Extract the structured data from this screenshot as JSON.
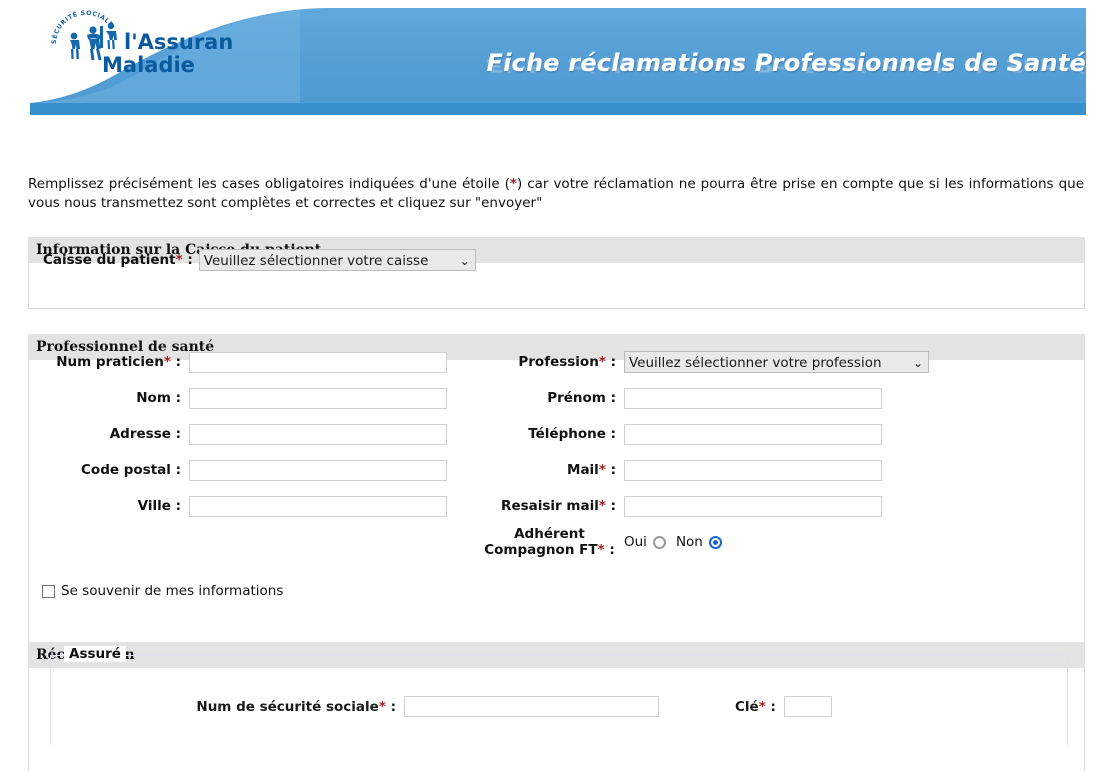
{
  "header": {
    "logo_top_text": "SÉCURITÉ SOCIALE",
    "logo_line1": "l'Assurance",
    "logo_line2": "Maladie",
    "title": "Fiche réclamations Professionnels de Santé",
    "brand_blue": "#5ba4da",
    "brand_blue_dark": "#2e86c8",
    "logo_blue": "#0a5aa0"
  },
  "intro": {
    "part1": "Remplissez précisément les cases obligatoires indiquées d'une étoile (",
    "asterisk": "*",
    "part2": ") car votre réclamation ne pourra être prise en compte que si les informations que vous nous transmettez sont complètes et correctes et cliquez sur \"envoyer\""
  },
  "sections": {
    "caisse": {
      "title": "Information sur la Caisse du patient",
      "label": "Caisse du patient",
      "required_mark": "*",
      "colon": " :",
      "select_value": "Veuillez sélectionner votre caisse",
      "chevron": "⌄"
    },
    "professionnel": {
      "title": "Professionnel de santé",
      "left_fields": [
        {
          "label": "Num praticien",
          "required": "*",
          "colon": " :",
          "value": ""
        },
        {
          "label": "Nom",
          "required": "",
          "colon": " :",
          "value": ""
        },
        {
          "label": "Adresse",
          "required": "",
          "colon": " :",
          "value": ""
        },
        {
          "label": "Code postal",
          "required": "",
          "colon": " :",
          "value": ""
        },
        {
          "label": "Ville",
          "required": "",
          "colon": " :",
          "value": ""
        }
      ],
      "profession": {
        "label": "Profession",
        "required": "*",
        "colon": " :",
        "select_value": "Veuillez sélectionner votre profession",
        "chevron": "⌄"
      },
      "right_fields": [
        {
          "label": "Prénom",
          "required": "",
          "colon": " :",
          "value": ""
        },
        {
          "label": "Téléphone",
          "required": "",
          "colon": " :",
          "value": ""
        },
        {
          "label": "Mail",
          "required": "*",
          "colon": " :",
          "value": ""
        },
        {
          "label": "Resaisir mail",
          "required": "*",
          "colon": " :",
          "value": ""
        }
      ],
      "adherent": {
        "label_line1": "Adhérent",
        "label_line2": "Compagnon FT",
        "required": "*",
        "colon": " :",
        "option_yes": "Oui",
        "option_no": "Non",
        "selected": "Non"
      },
      "remember": {
        "label": "Se souvenir de mes informations",
        "checked": false
      }
    },
    "reclamation": {
      "title": "Réclamation",
      "assure_legend": "Assuré",
      "num_secu": {
        "label": "Num de sécurité sociale",
        "required": "*",
        "colon": " :",
        "value": ""
      },
      "cle": {
        "label": "Clé",
        "required": "*",
        "colon": " :",
        "value": ""
      }
    }
  }
}
